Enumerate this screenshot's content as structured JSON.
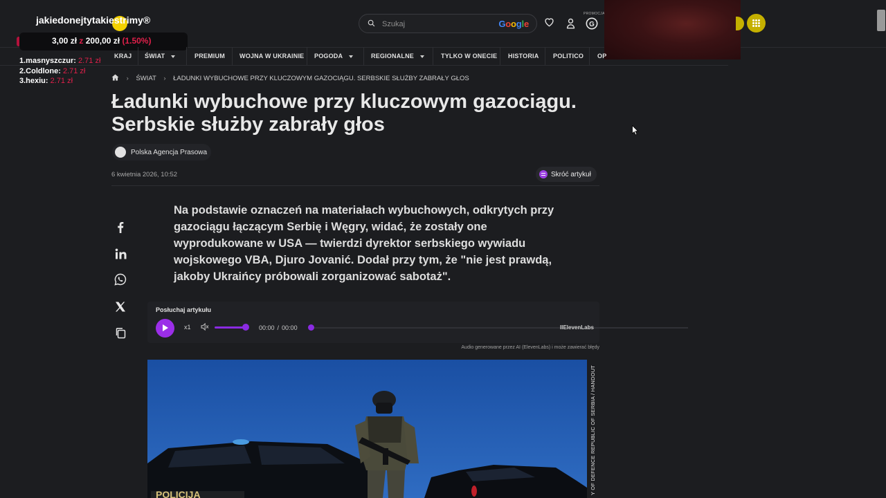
{
  "header": {
    "search_placeholder": "Szukaj",
    "google_label": "Google",
    "promo_label": "PROMOCJA"
  },
  "overlay": {
    "title": "jakiedonejtytakiestrimy®",
    "amount": "3,00 zł",
    "amount_sep": "z",
    "goal": "200,00 zł",
    "percent": "(1.50%)",
    "donors": [
      {
        "name": "1.masnyszczur:",
        "amount": "2.71 zł"
      },
      {
        "name": "2.Coldlone:",
        "amount": "2.71 zł"
      },
      {
        "name": "3.hexiu:",
        "amount": "2.71 zł"
      }
    ]
  },
  "nav": {
    "items": [
      "KRAJ",
      "ŚWIAT",
      "PREMIUM",
      "WOJNA W UKRAINIE",
      "POGODA",
      "REGIONALNE",
      "TYLKO W ONECIE",
      "HISTORIA",
      "POLITICO",
      "OP"
    ]
  },
  "breadcrumb": {
    "section": "ŚWIAT",
    "current": "ŁADUNKI WYBUCHOWE PRZY KLUCZOWYM GAZOCIĄGU. SERBSKIE SŁUŻBY ZABRAŁY GŁOS"
  },
  "article": {
    "title": "Ładunki wybuchowe przy kluczowym gazociągu. Serbskie służby zabrały głos",
    "author": "Polska Agencja Prasowa",
    "date": "6 kwietnia 2026, 10:52",
    "summary_button": "Skróć artykuł",
    "lead": "Na podstawie oznaczeń na materiałach wybuchowych, odkrytych przy gazociągu łączącym Serbię i Węgry, widać, że zostały one wyprodukowane w USA — twierdzi dyrektor serbskiego wywiadu wojskowego VBA, Djuro Jovanić. Dodał przy tym, że \"nie jest prawdą, jakoby Ukraińcy próbowali zorganizować sabotaż\"."
  },
  "audio": {
    "label": "Posłuchaj artykułu",
    "speed": "x1",
    "current_time": "00:00",
    "separator": "/",
    "duration": "00:00",
    "brand": "IIElevenLabs",
    "note": "Audio generowane przez AI (ElevenLabs) i może zawierać błędy",
    "progress": 0
  },
  "photo": {
    "credit": "Y OF DEFENCE REPUBLIC OF SERBIA / HANDOUT"
  },
  "colors": {
    "background": "#1c1d20",
    "accent_purple": "#9b2ee8",
    "overlay_red": "#e0204a",
    "grid_button": "#c5b000"
  },
  "icons": [
    "search-icon",
    "heart-icon",
    "user-icon",
    "g-promo-icon",
    "apps-grid-icon",
    "home-icon",
    "facebook-icon",
    "linkedin-icon",
    "whatsapp-icon",
    "x-icon",
    "copy-icon",
    "volume-icon"
  ]
}
